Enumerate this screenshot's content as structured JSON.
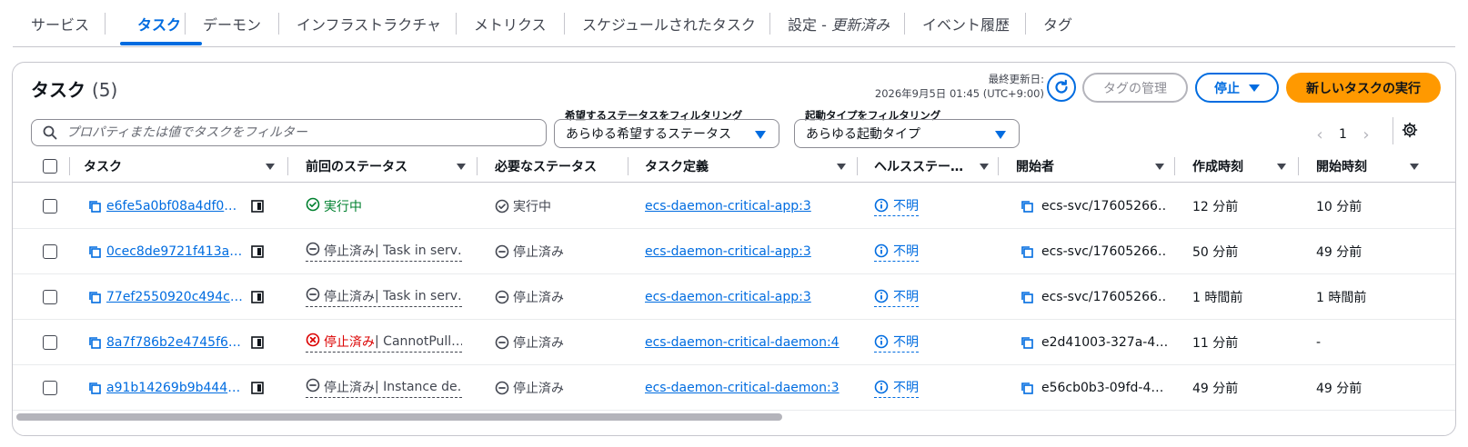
{
  "tabs": [
    {
      "label": "サービス"
    },
    {
      "label": "タスク"
    },
    {
      "label": "デーモン"
    },
    {
      "label": "インフラストラクチャ"
    },
    {
      "label": "メトリクス"
    },
    {
      "label": "スケジュールされたタスク"
    },
    {
      "label": "設定 -",
      "suffix": "更新済み"
    },
    {
      "label": "イベント履歴"
    },
    {
      "label": "タグ"
    }
  ],
  "panel": {
    "title": "タスク",
    "count": "(5)",
    "last_updated_label": "最終更新日:",
    "last_updated_value": "2026年9月5日 01:45 (UTC+9:00)",
    "manage_tags_label": "タグの管理",
    "stop_label": "停止",
    "run_task_label": "新しいタスクの実行"
  },
  "filters": {
    "search_placeholder": "プロパティまたは値でタスクをフィルター",
    "desired_status_label": "希望するステータスをフィルタリング",
    "desired_status_value": "あらゆる希望するステータス",
    "launch_type_label": "起動タイプをフィルタリング",
    "launch_type_value": "あらゆる起動タイプ"
  },
  "pagination": {
    "page": "1"
  },
  "columns": {
    "task": "タスク",
    "last_status": "前回のステータス",
    "desired_status": "必要なステータス",
    "task_definition": "タスク定義",
    "health_status": "ヘルスステー…",
    "started_by": "開始者",
    "created_at": "作成時刻",
    "started_at": "開始時刻"
  },
  "rows": [
    {
      "task": "e6fe5a0bf08a4df0b4…",
      "last_status": "実行中",
      "last_status_detail": "",
      "desired_status": "実行中",
      "task_definition": "ecs-daemon-critical-app:3",
      "health": "不明",
      "started_by": "ecs-svc/17605266…",
      "created_at": "12 分前",
      "started_at": "10 分前"
    },
    {
      "task": "0cec8de9721f413a9…",
      "last_status": "停止済み",
      "last_status_detail": " | Task in serv…",
      "desired_status": "停止済み",
      "task_definition": "ecs-daemon-critical-app:3",
      "health": "不明",
      "started_by": "ecs-svc/17605266…",
      "created_at": "50 分前",
      "started_at": "49 分前"
    },
    {
      "task": "77ef2550920c494c8…",
      "last_status": "停止済み",
      "last_status_detail": " | Task in serv…",
      "desired_status": "停止済み",
      "task_definition": "ecs-daemon-critical-app:3",
      "health": "不明",
      "started_by": "ecs-svc/17605266…",
      "created_at": "1 時間前",
      "started_at": "1 時間前"
    },
    {
      "task": "8a7f786b2e4745f69…",
      "last_status": "停止済み",
      "last_status_detail": " | CannotPull…",
      "desired_status": "停止済み",
      "task_definition": "ecs-daemon-critical-daemon:4",
      "health": "不明",
      "started_by": "e2d41003-327a-4…",
      "created_at": "11 分前",
      "started_at": "-"
    },
    {
      "task": "a91b14269b9b444f8…",
      "last_status": "停止済み",
      "last_status_detail": " | Instance de…",
      "desired_status": "停止済み",
      "task_definition": "ecs-daemon-critical-daemon:3",
      "health": "不明",
      "started_by": "e56cb0b3-09fd-4…",
      "created_at": "49 分前",
      "started_at": "49 分前"
    }
  ],
  "colors": {
    "accent": "#006ce0",
    "primary_button": "#ff9900",
    "running": "#00802f",
    "error": "#db0000"
  }
}
